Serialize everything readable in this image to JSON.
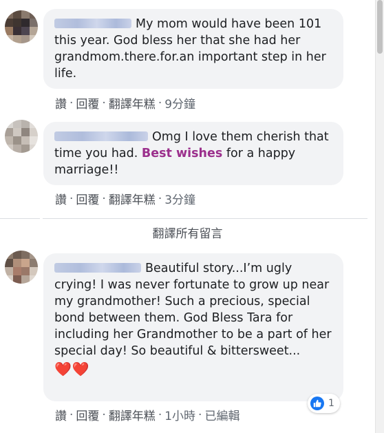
{
  "comments": [
    {
      "author_blurred": true,
      "text": "My mom would have been 101 this year. God bless her that she had her grandmom.there.for.an important step in her life.",
      "actions": {
        "like": "讚",
        "reply": "回覆",
        "translate": "翻譯年糕",
        "time": "9分鐘",
        "sep": "·"
      }
    },
    {
      "author_blurred": true,
      "text_before": "Omg I love them cherish that time you had. ",
      "highlight": "Best wishes",
      "text_after": " for a happy marriage!!",
      "actions": {
        "like": "讚",
        "reply": "回覆",
        "translate": "翻譯年糕",
        "time": "3分鐘",
        "sep": "·"
      }
    },
    {
      "author_blurred": true,
      "text": "Beautiful story...I’m ugly crying! I was never fortunate to grow up near my grandmother! Such a precious, special bond between them. God Bless Tara for including her Grandmother to be a part of her special day! So beautiful & bittersweet...",
      "emoji": "❤️❤️",
      "actions": {
        "like": "讚",
        "reply": "回覆",
        "translate": "翻譯年糕",
        "time": "1小時",
        "edited": "已編輯",
        "sep": "·"
      },
      "reactions": {
        "icon": "like-icon",
        "count": "1",
        "color": "#1877f2"
      }
    }
  ],
  "translate_all": "翻譯所有留言",
  "colors": {
    "bubble": "#f2f3f5",
    "highlight": "#9b2f8c",
    "action_text": "#4b4f56"
  }
}
